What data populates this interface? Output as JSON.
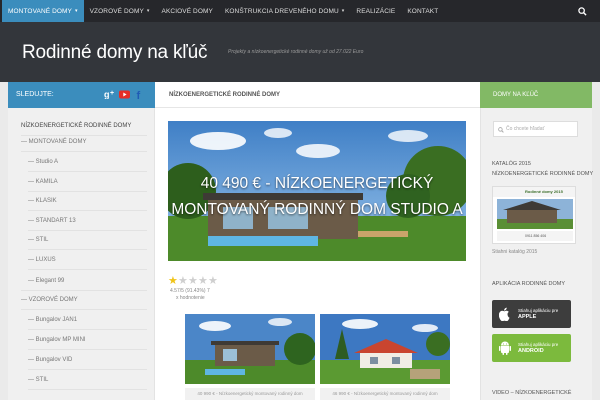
{
  "nav": {
    "items": [
      {
        "label": "MONTOVANÉ DOMY",
        "caret": "▾"
      },
      {
        "label": "VZOROVÉ DOMY",
        "caret": "▾"
      },
      {
        "label": "AKCIOVÉ DOMY",
        "caret": ""
      },
      {
        "label": "KONŠTRUKCIA DREVENÉHO DOMU",
        "caret": "▾"
      },
      {
        "label": "REALIZÁCIE",
        "caret": ""
      },
      {
        "label": "KONTAKT",
        "caret": ""
      }
    ],
    "search_icon": "search-icon",
    "accent": "#3b8dbd"
  },
  "header": {
    "title": "Rodinné domy na kľúč",
    "tagline": "Projekty a nízkoenergetické rodinné domy už od 27.022 Euro"
  },
  "left_sidebar": {
    "heading": "SLEDUJTE:",
    "social_icons": [
      "google-plus-icon",
      "youtube-icon",
      "facebook-icon"
    ],
    "items": [
      "NÍZKOENERGETICKÉ RODINNÉ DOMY",
      "— MONTOVANÉ DOMY",
      "— Studio A",
      "— KAMILA",
      "— KLASIK",
      "— STANDART 13",
      "— STIL",
      "— LUXUS",
      "— Elegant 99",
      "— VZOROVÉ DOMY",
      "— Bungalov JAN1",
      "— Bungalov MP MINI",
      "— Bungalov VID",
      "— STIL"
    ]
  },
  "main": {
    "heading": "NÍZKOENERGETICKÉ RODINNÉ DOMY",
    "hero_text": "40 490 € - NÍZKOENERGETICKÝ MONTOVANÝ RODINNÝ DOM STUDIO A",
    "rating": {
      "value": 1,
      "max": 5,
      "text": "4.57/5 (91.43%) 7",
      "sub": "x hodnotenie"
    },
    "thumbnails": [
      {
        "caption": "40 990 € - Nízkoenergetický montovaný rodinný dom"
      },
      {
        "caption": "46 990 € - Nízkoenergetický montovaný rodinný dom"
      }
    ]
  },
  "right_sidebar": {
    "heading": "DOMY NA KĽÚČ",
    "search_placeholder": "Čo chcete hľadať",
    "catalog_title_1": "KATALÓG 2015",
    "catalog_title_2": "NÍZKOENERGETICKÉ RODINNÉ DOMY",
    "catalog_image_title": "Rodinné domy 2015",
    "catalog_phone": "0911 856 406",
    "catalog_link": "Stiahni katalóg 2015",
    "app_heading": "APLIKÁCIA RODINNÉ DOMY",
    "apple": {
      "line1": "Stiahuj aplikáciu pre",
      "line2": "APPLE",
      "color": "#3d3d3d"
    },
    "android": {
      "line1": "Stiahuj aplikáciu pre",
      "line2": "ANDROID",
      "color": "#7cba3d"
    },
    "video_heading": "VIDEO – NÍZKOENERGETICKÉ"
  },
  "colors": {
    "left_head": "#3b8dbd",
    "right_head": "#82b965",
    "dark": "#33363b"
  }
}
